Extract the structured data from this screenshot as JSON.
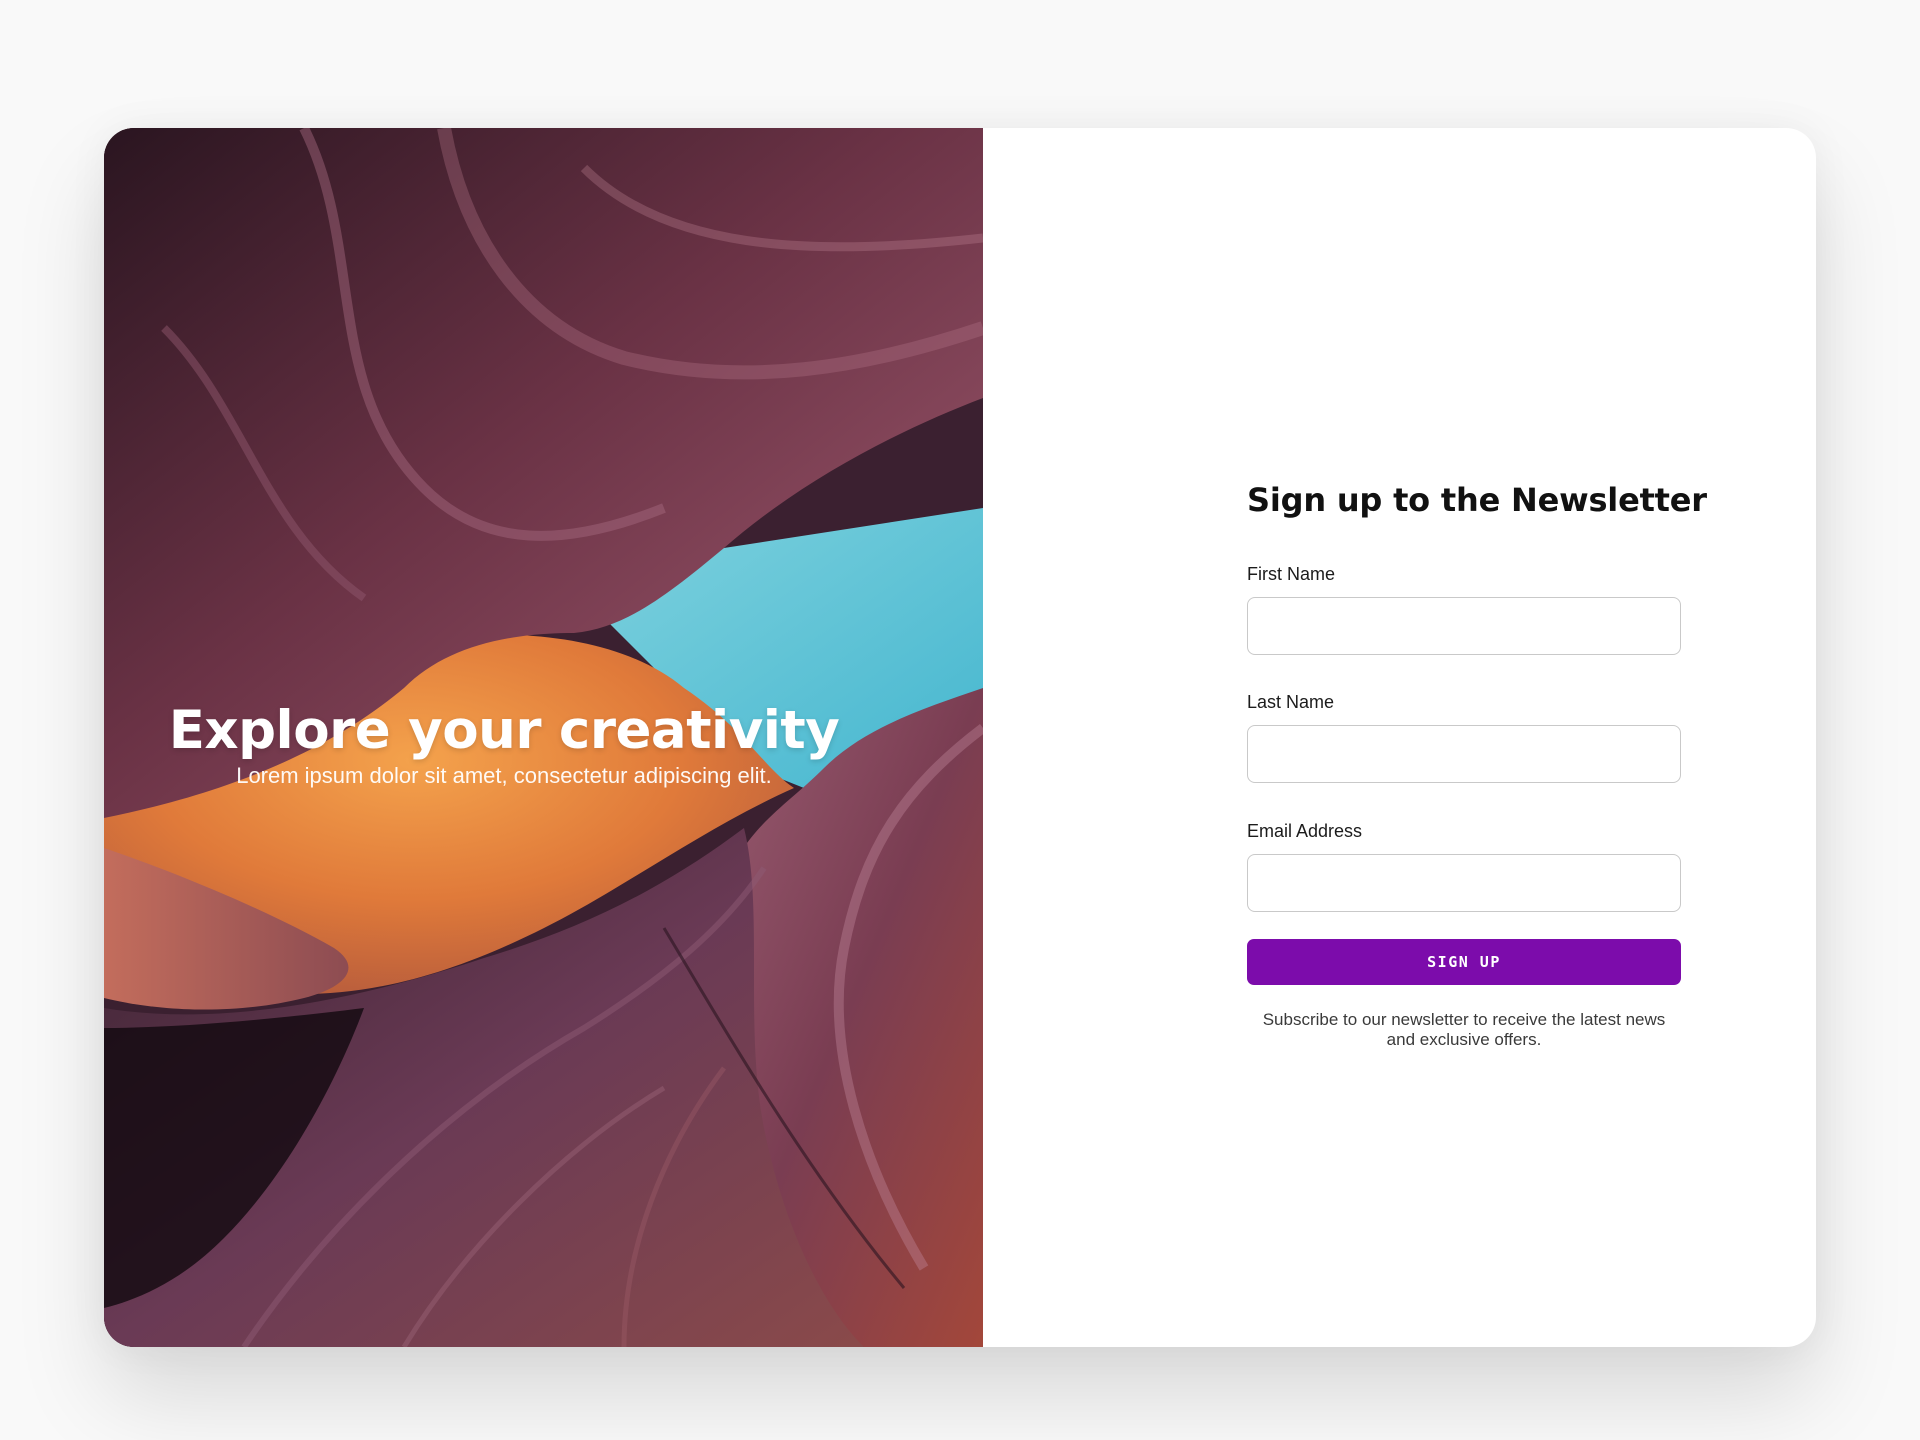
{
  "hero": {
    "title": "Explore your creativity",
    "subtitle": "Lorem ipsum dolor sit amet, consectetur adipiscing elit.",
    "image": "slot-canyon-photo"
  },
  "form": {
    "title": "Sign up to the Newsletter",
    "fields": [
      {
        "label": "First Name",
        "value": "",
        "placeholder": ""
      },
      {
        "label": "Last Name",
        "value": "",
        "placeholder": ""
      },
      {
        "label": "Email Address",
        "value": "",
        "placeholder": ""
      }
    ],
    "submit_label": "SIGN UP",
    "note": "Subscribe to our newsletter to receive the latest news and exclusive offers."
  },
  "colors": {
    "accent": "#7c0cab",
    "background": "#f9f9f9",
    "card": "#ffffff",
    "sky": "#5cc4d6",
    "sandstone_orange": "#e6863f",
    "rock_purple": "#5a3148"
  }
}
